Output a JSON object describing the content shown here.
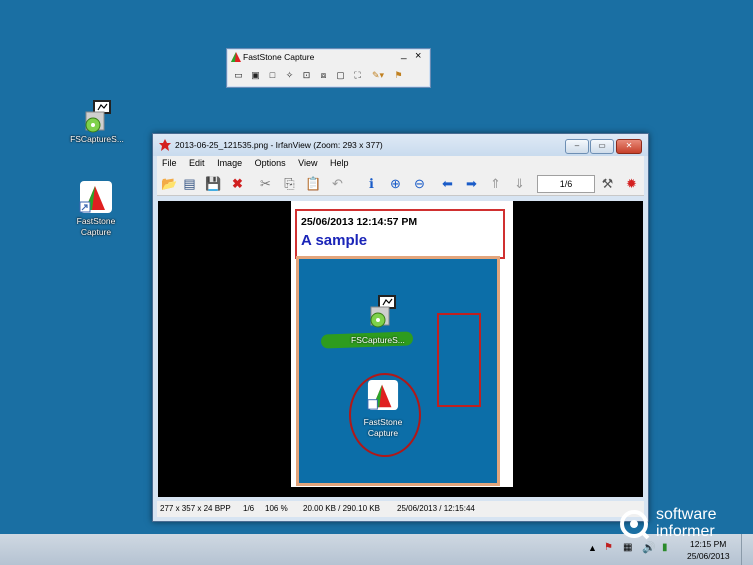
{
  "desktop": {
    "icons": [
      {
        "label": "FSCaptureS..."
      },
      {
        "label_line1": "FastStone",
        "label_line2": "Capture"
      }
    ]
  },
  "faststone_bar": {
    "title": "FastStone Capture",
    "minimize": "_",
    "close": "×"
  },
  "irfanview": {
    "title": "2013-06-25_121535.png - IrfanView (Zoom: 293 x 377)",
    "menu": [
      "File",
      "Edit",
      "Image",
      "Options",
      "View",
      "Help"
    ],
    "page_indicator": "1/6",
    "image": {
      "timestamp": "25/06/2013 12:14:57 PM",
      "heading": "A sample",
      "icon1_label": "FSCaptureS...",
      "icon2_line1": "FastStone",
      "icon2_line2": "Capture"
    },
    "status": {
      "dimensions": "277 x 357 x 24 BPP",
      "page": "1/6",
      "zoom": "106 %",
      "size": "20.00 KB / 290.10 KB",
      "datetime": "25/06/2013 / 12:15:44"
    }
  },
  "taskbar": {
    "time": "12:15 PM",
    "date": "25/06/2013"
  },
  "watermark": {
    "line1": "software",
    "line2": "informer"
  },
  "colors": {
    "desktop": "#1a6fa3",
    "annotation_red": "#d03030",
    "heading_blue": "#1a24b8"
  }
}
